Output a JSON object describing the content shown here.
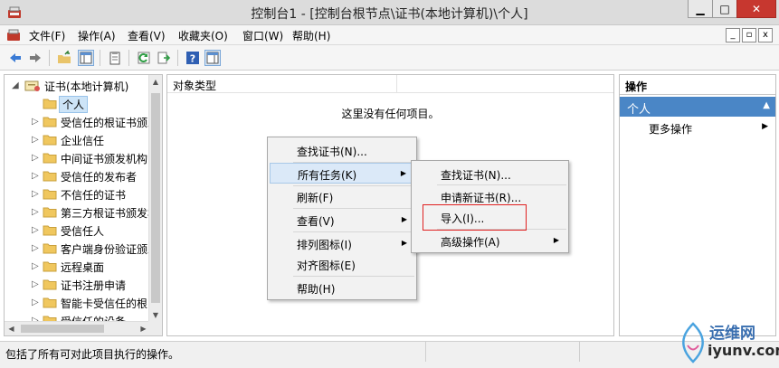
{
  "window": {
    "title": "控制台1 - [控制台根节点\\证书(本地计算机)\\个人]",
    "min_glyph": "▁",
    "max_glyph": "□",
    "close_glyph": "✕"
  },
  "menubar": {
    "items": [
      "文件(F)",
      "操作(A)",
      "查看(V)",
      "收藏夹(O)",
      "窗口(W)",
      "帮助(H)"
    ],
    "mdi_min": "_",
    "mdi_restore": "▫",
    "mdi_close": "x"
  },
  "tree": {
    "root": "证书(本地计算机)",
    "selected": "个人",
    "items": [
      "受信任的根证书颁发机构",
      "企业信任",
      "中间证书颁发机构",
      "受信任的发布者",
      "不信任的证书",
      "第三方根证书颁发机构",
      "受信任人",
      "客户端身份验证颁发者",
      "远程桌面",
      "证书注册申请",
      "智能卡受信任的根",
      "受信任的设备"
    ]
  },
  "center": {
    "column_header": "对象类型",
    "empty_message": "这里没有任何项目。"
  },
  "context_menu": {
    "items": [
      "查找证书(N)...",
      "所有任务(K)",
      "刷新(F)",
      "查看(V)",
      "排列图标(I)",
      "对齐图标(E)",
      "帮助(H)"
    ]
  },
  "submenu": {
    "items": [
      "查找证书(N)...",
      "申请新证书(R)...",
      "导入(I)...",
      "高级操作(A)"
    ]
  },
  "actions": {
    "title": "操作",
    "section": "个人",
    "more": "更多操作"
  },
  "status": {
    "text": "包括了所有可对此项目执行的操作。"
  },
  "watermark": {
    "text": "运维网",
    "url": "iyunv.com"
  },
  "colors": {
    "accent": "#4a86c6",
    "selection": "#cde4f7",
    "close_button": "#c7372f",
    "highlight_box": "#e02020"
  }
}
